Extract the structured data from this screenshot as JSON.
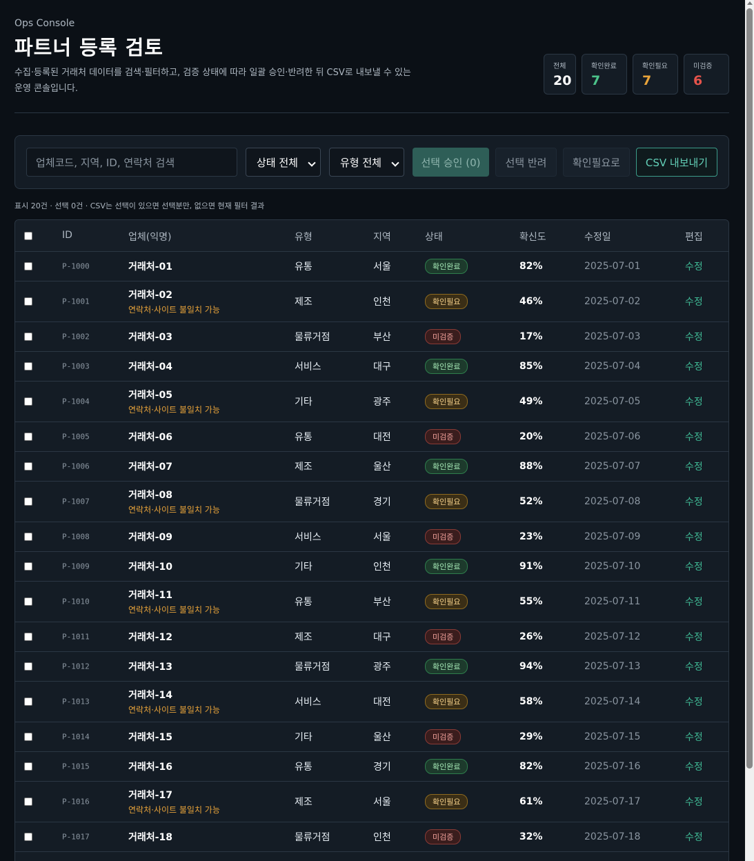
{
  "header": {
    "eyebrow": "Ops Console",
    "title": "파트너 등록 검토",
    "description": "수집·등록된 거래처 데이터를 검색·필터하고, 검증 상태에 따라 일괄 승인·반려한 뒤 CSV로 내보낼 수 있는 운영 콘솔입니다."
  },
  "stats": [
    {
      "label": "전체",
      "value": "20",
      "color": "#ffffff"
    },
    {
      "label": "확인완료",
      "value": "7",
      "color": "#4cc38a"
    },
    {
      "label": "확인필요",
      "value": "7",
      "color": "#e8a33a"
    },
    {
      "label": "미검증",
      "value": "6",
      "color": "#e5534b"
    }
  ],
  "toolbar": {
    "search_placeholder": "업체코드, 지역, ID, 연락처 검색",
    "status_select": "상태 전체",
    "type_select": "유형 전체",
    "approve_label": "선택 승인 (0)",
    "reject_label": "선택 반려",
    "need_label": "확인필요로",
    "csv_label": "CSV 내보내기"
  },
  "info": "표시 20건 · 선택 0건 · CSV는 선택이 있으면 선택분만, 없으면 현재 필터 결과",
  "table": {
    "columns": [
      "ID",
      "업체(익명)",
      "유형",
      "지역",
      "상태",
      "확신도",
      "수정일",
      "편집"
    ],
    "warning_text": "연락처·사이트 불일치 가능",
    "edit_label": "수정",
    "rows": [
      {
        "id": "P-1000",
        "name": "거래처-01",
        "type": "유통",
        "region": "서울",
        "status": "확인완료",
        "conf": "82%",
        "date": "2025-07-01",
        "warn": false
      },
      {
        "id": "P-1001",
        "name": "거래처-02",
        "type": "제조",
        "region": "인천",
        "status": "확인필요",
        "conf": "46%",
        "date": "2025-07-02",
        "warn": true
      },
      {
        "id": "P-1002",
        "name": "거래처-03",
        "type": "물류거점",
        "region": "부산",
        "status": "미검증",
        "conf": "17%",
        "date": "2025-07-03",
        "warn": false
      },
      {
        "id": "P-1003",
        "name": "거래처-04",
        "type": "서비스",
        "region": "대구",
        "status": "확인완료",
        "conf": "85%",
        "date": "2025-07-04",
        "warn": false
      },
      {
        "id": "P-1004",
        "name": "거래처-05",
        "type": "기타",
        "region": "광주",
        "status": "확인필요",
        "conf": "49%",
        "date": "2025-07-05",
        "warn": true
      },
      {
        "id": "P-1005",
        "name": "거래처-06",
        "type": "유통",
        "region": "대전",
        "status": "미검증",
        "conf": "20%",
        "date": "2025-07-06",
        "warn": false
      },
      {
        "id": "P-1006",
        "name": "거래처-07",
        "type": "제조",
        "region": "울산",
        "status": "확인완료",
        "conf": "88%",
        "date": "2025-07-07",
        "warn": false
      },
      {
        "id": "P-1007",
        "name": "거래처-08",
        "type": "물류거점",
        "region": "경기",
        "status": "확인필요",
        "conf": "52%",
        "date": "2025-07-08",
        "warn": true
      },
      {
        "id": "P-1008",
        "name": "거래처-09",
        "type": "서비스",
        "region": "서울",
        "status": "미검증",
        "conf": "23%",
        "date": "2025-07-09",
        "warn": false
      },
      {
        "id": "P-1009",
        "name": "거래처-10",
        "type": "기타",
        "region": "인천",
        "status": "확인완료",
        "conf": "91%",
        "date": "2025-07-10",
        "warn": false
      },
      {
        "id": "P-1010",
        "name": "거래처-11",
        "type": "유통",
        "region": "부산",
        "status": "확인필요",
        "conf": "55%",
        "date": "2025-07-11",
        "warn": true
      },
      {
        "id": "P-1011",
        "name": "거래처-12",
        "type": "제조",
        "region": "대구",
        "status": "미검증",
        "conf": "26%",
        "date": "2025-07-12",
        "warn": false
      },
      {
        "id": "P-1012",
        "name": "거래처-13",
        "type": "물류거점",
        "region": "광주",
        "status": "확인완료",
        "conf": "94%",
        "date": "2025-07-13",
        "warn": false
      },
      {
        "id": "P-1013",
        "name": "거래처-14",
        "type": "서비스",
        "region": "대전",
        "status": "확인필요",
        "conf": "58%",
        "date": "2025-07-14",
        "warn": true
      },
      {
        "id": "P-1014",
        "name": "거래처-15",
        "type": "기타",
        "region": "울산",
        "status": "미검증",
        "conf": "29%",
        "date": "2025-07-15",
        "warn": false
      },
      {
        "id": "P-1015",
        "name": "거래처-16",
        "type": "유통",
        "region": "경기",
        "status": "확인완료",
        "conf": "82%",
        "date": "2025-07-16",
        "warn": false
      },
      {
        "id": "P-1016",
        "name": "거래처-17",
        "type": "제조",
        "region": "서울",
        "status": "확인필요",
        "conf": "61%",
        "date": "2025-07-17",
        "warn": true
      },
      {
        "id": "P-1017",
        "name": "거래처-18",
        "type": "물류거점",
        "region": "인천",
        "status": "미검증",
        "conf": "32%",
        "date": "2025-07-18",
        "warn": false
      }
    ]
  }
}
